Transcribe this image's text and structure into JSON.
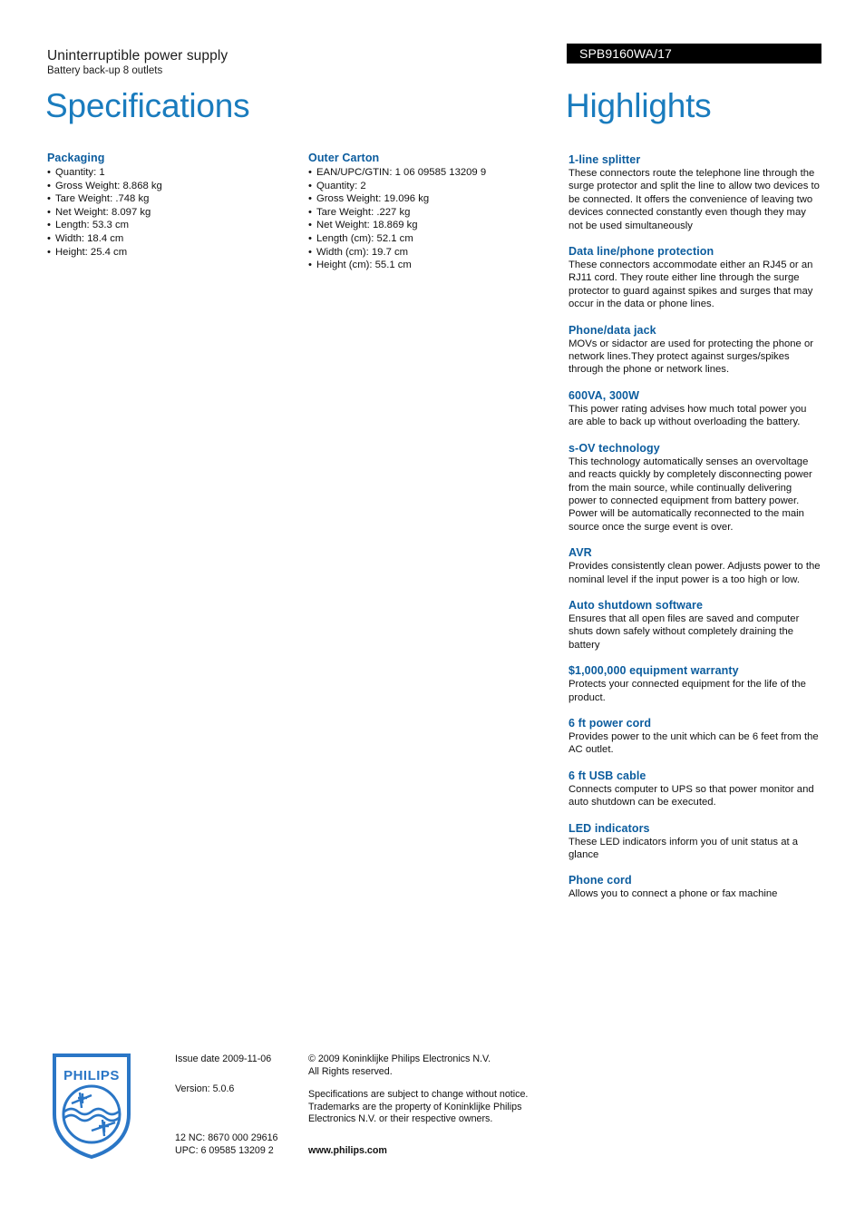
{
  "header": {
    "product_title": "Uninterruptible power supply",
    "product_subtitle": "Battery back-up 8 outlets",
    "product_code": "SPB9160WA/17",
    "left_title": "Specifications",
    "right_title": "Highlights",
    "accent_blue": "#1a7cbe",
    "heading_blue": "#0b5c9e",
    "code_bar_bg": "#000000"
  },
  "specifications": {
    "column1": [
      {
        "heading": "Packaging",
        "items": [
          "Quantity: 1",
          "Gross Weight: 8.868 kg",
          "Tare Weight: .748 kg",
          "Net Weight: 8.097 kg",
          "Length: 53.3 cm",
          "Width: 18.4 cm",
          "Height: 25.4 cm"
        ]
      }
    ],
    "column2": [
      {
        "heading": "Outer Carton",
        "items": [
          "EAN/UPC/GTIN: 1 06 09585 13209 9",
          "Quantity: 2",
          "Gross Weight: 19.096 kg",
          "Tare Weight: .227 kg",
          "Net Weight: 18.869 kg",
          "Length (cm): 52.1 cm",
          "Width (cm): 19.7 cm",
          "Height (cm): 55.1 cm"
        ]
      }
    ]
  },
  "highlights": [
    {
      "heading": "1-line splitter",
      "body": "These connectors route the telephone line through the surge protector and split the line to allow two devices to be connected. It offers the convenience of leaving two devices connected constantly even though they may not be used simultaneously"
    },
    {
      "heading": "Data line/phone protection",
      "body": "These connectors accommodate either an RJ45 or an RJ11 cord. They route either line through the surge protector to guard against spikes and surges that may occur in the data or phone lines."
    },
    {
      "heading": "Phone/data jack",
      "body": "MOVs or sidactor are used for protecting the phone or network lines.They protect against surges/spikes through the phone or network lines."
    },
    {
      "heading": "600VA, 300W",
      "body": "This power rating advises how much total power you are able to back up without overloading the battery."
    },
    {
      "heading": "s-OV technology",
      "body": "This technology automatically senses an overvoltage and reacts quickly by completely disconnecting power from the main source, while continually delivering power to connected equipment from battery power. Power will be automatically reconnected to the main source once the surge event is over."
    },
    {
      "heading": "AVR",
      "body": "Provides consistently clean power. Adjusts power to the nominal level if the input power is a too high or low."
    },
    {
      "heading": "Auto shutdown software",
      "body": "Ensures that all open files are saved and computer shuts down safely without completely draining the battery"
    },
    {
      "heading": "$1,000,000 equipment warranty",
      "body": "Protects your connected equipment for the life of the product."
    },
    {
      "heading": "6 ft power cord",
      "body": "Provides power to the unit which can be 6 feet from the AC outlet."
    },
    {
      "heading": "6 ft USB cable",
      "body": "Connects computer to UPS so that power monitor and auto shutdown can be executed."
    },
    {
      "heading": "LED indicators",
      "body": "These LED indicators inform you of unit status at a glance"
    },
    {
      "heading": "Phone cord",
      "body": "Allows you to connect a phone or fax machine"
    }
  ],
  "footer": {
    "logo_wordmark": "PHILIPS",
    "issue_date": "Issue date 2009-11-06",
    "version": "Version: 5.0.6",
    "nc_code": "12 NC: 8670 000 29616",
    "upc_code": "UPC: 6 09585 13209 2",
    "copyright_line1": "© 2009 Koninklijke Philips Electronics N.V.",
    "copyright_line2": "All Rights reserved.",
    "disclaimer_line1": "Specifications are subject to change without notice.",
    "disclaimer_line2": "Trademarks are the property of Koninklijke Philips",
    "disclaimer_line3": "Electronics N.V. or their respective owners.",
    "website": "www.philips.com"
  }
}
